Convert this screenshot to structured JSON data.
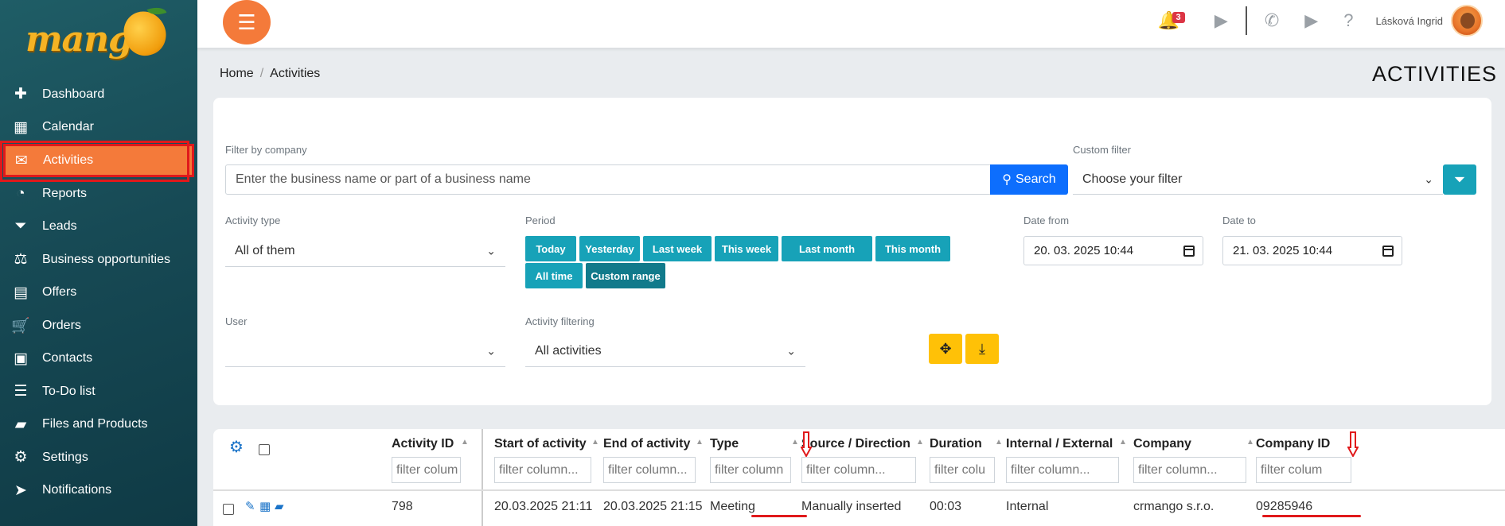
{
  "app": {
    "logo_text": "mango"
  },
  "sidebar": {
    "items": [
      {
        "label": "Dashboard",
        "icon": "puzzle-icon",
        "glyph": "✚"
      },
      {
        "label": "Calendar",
        "icon": "calendar-icon",
        "glyph": "▦"
      },
      {
        "label": "Activities",
        "icon": "activities-icon",
        "glyph": "✉",
        "active": true
      },
      {
        "label": "Reports",
        "icon": "pie-chart-icon",
        "glyph": "◔"
      },
      {
        "label": "Leads",
        "icon": "funnel-dollar-icon",
        "glyph": "⏷"
      },
      {
        "label": "Business opportunities",
        "icon": "scale-icon",
        "glyph": "⚖"
      },
      {
        "label": "Offers",
        "icon": "document-icon",
        "glyph": "▤"
      },
      {
        "label": "Orders",
        "icon": "cart-icon",
        "glyph": "🛒"
      },
      {
        "label": "Contacts",
        "icon": "contact-card-icon",
        "glyph": "▣"
      },
      {
        "label": "To-Do list",
        "icon": "checklist-icon",
        "glyph": "☰"
      },
      {
        "label": "Files and Products",
        "icon": "folder-icon",
        "glyph": "▰"
      },
      {
        "label": "Settings",
        "icon": "gears-icon",
        "glyph": "⚙"
      },
      {
        "label": "Notifications",
        "icon": "paper-plane-icon",
        "glyph": "➤"
      }
    ]
  },
  "topbar": {
    "notification_count": "3",
    "user_name": "Lásková Ingrid"
  },
  "breadcrumb": {
    "home": "Home",
    "current": "Activities"
  },
  "page_title": "ACTIVITIES",
  "filters": {
    "company_label": "Filter by company",
    "company_placeholder": "Enter the business name or part of a business name",
    "search_label": "Search",
    "custom_filter_label": "Custom filter",
    "custom_filter_value": "Choose your filter",
    "activity_type_label": "Activity type",
    "activity_type_value": "All of them",
    "period_label": "Period",
    "period_buttons": [
      "Today",
      "Yesterday",
      "Last week",
      "This week",
      "Last month",
      "This month",
      "All time",
      "Custom range"
    ],
    "date_from_label": "Date from",
    "date_from_value": "20. 03. 2025 10:44",
    "date_to_label": "Date to",
    "date_to_value": "21. 03. 2025 10:44",
    "user_label": "User",
    "user_value": "",
    "activity_filtering_label": "Activity filtering",
    "activity_filtering_value": "All activities"
  },
  "table": {
    "columns": [
      "Activity ID",
      "Start of activity",
      "End of activity",
      "Type",
      "Source / Direction",
      "Duration",
      "Internal / External",
      "Company",
      "Company ID"
    ],
    "filter_placeholders": [
      "filter colum",
      "filter column...",
      "filter column...",
      "filter column",
      "filter column...",
      "filter colu",
      "filter column...",
      "filter column...",
      "filter colum"
    ],
    "rows": [
      [
        "798",
        "20.03.2025 21:11",
        "20.03.2025 21:15",
        "Meeting",
        "Manually inserted",
        "00:03",
        "Internal",
        "crmango s.r.o.",
        "09285946"
      ]
    ]
  },
  "colors": {
    "sidebar": "#174a55",
    "accent": "#f47a3a",
    "teal": "#17a2b8",
    "primary": "#0d6efd",
    "yellow": "#ffc107",
    "annotation": "#e0191b"
  }
}
